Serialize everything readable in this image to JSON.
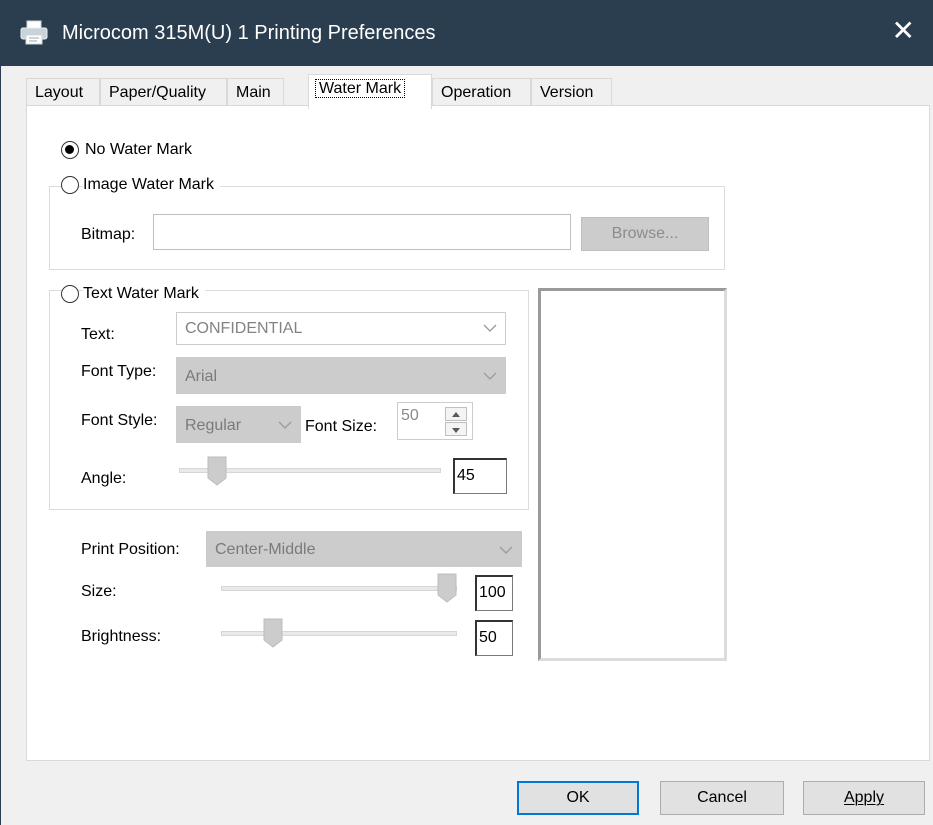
{
  "window": {
    "title": "Microcom 315M(U) 1 Printing Preferences",
    "close": "✕"
  },
  "tabs": [
    "Layout",
    "Paper/Quality",
    "Main",
    "Water Mark",
    "Operation",
    "Version"
  ],
  "active_tab": "Water Mark",
  "watermark": {
    "mode": "No Water Mark",
    "no_watermark_label": "No Water Mark",
    "image_watermark_label": "Image Water Mark",
    "bitmap_label": "Bitmap:",
    "bitmap_value": "",
    "browse_label": "Browse...",
    "text_watermark_label": "Text Water Mark",
    "text_label": "Text:",
    "text_value": "CONFIDENTIAL",
    "font_type_label": "Font Type:",
    "font_type_value": "Arial",
    "font_style_label": "Font Style:",
    "font_style_value": "Regular",
    "font_size_label": "Font Size:",
    "font_size_value": "50",
    "angle_label": "Angle:",
    "angle_value": "45",
    "print_position_label": "Print Position:",
    "print_position_value": "Center-Middle",
    "size_label": "Size:",
    "size_value": "100",
    "brightness_label": "Brightness:",
    "brightness_value": "50"
  },
  "buttons": {
    "ok": "OK",
    "cancel": "Cancel",
    "apply": "Apply"
  },
  "colors": {
    "titlebar": "#2b3e50",
    "focus_border": "#0078d7"
  }
}
